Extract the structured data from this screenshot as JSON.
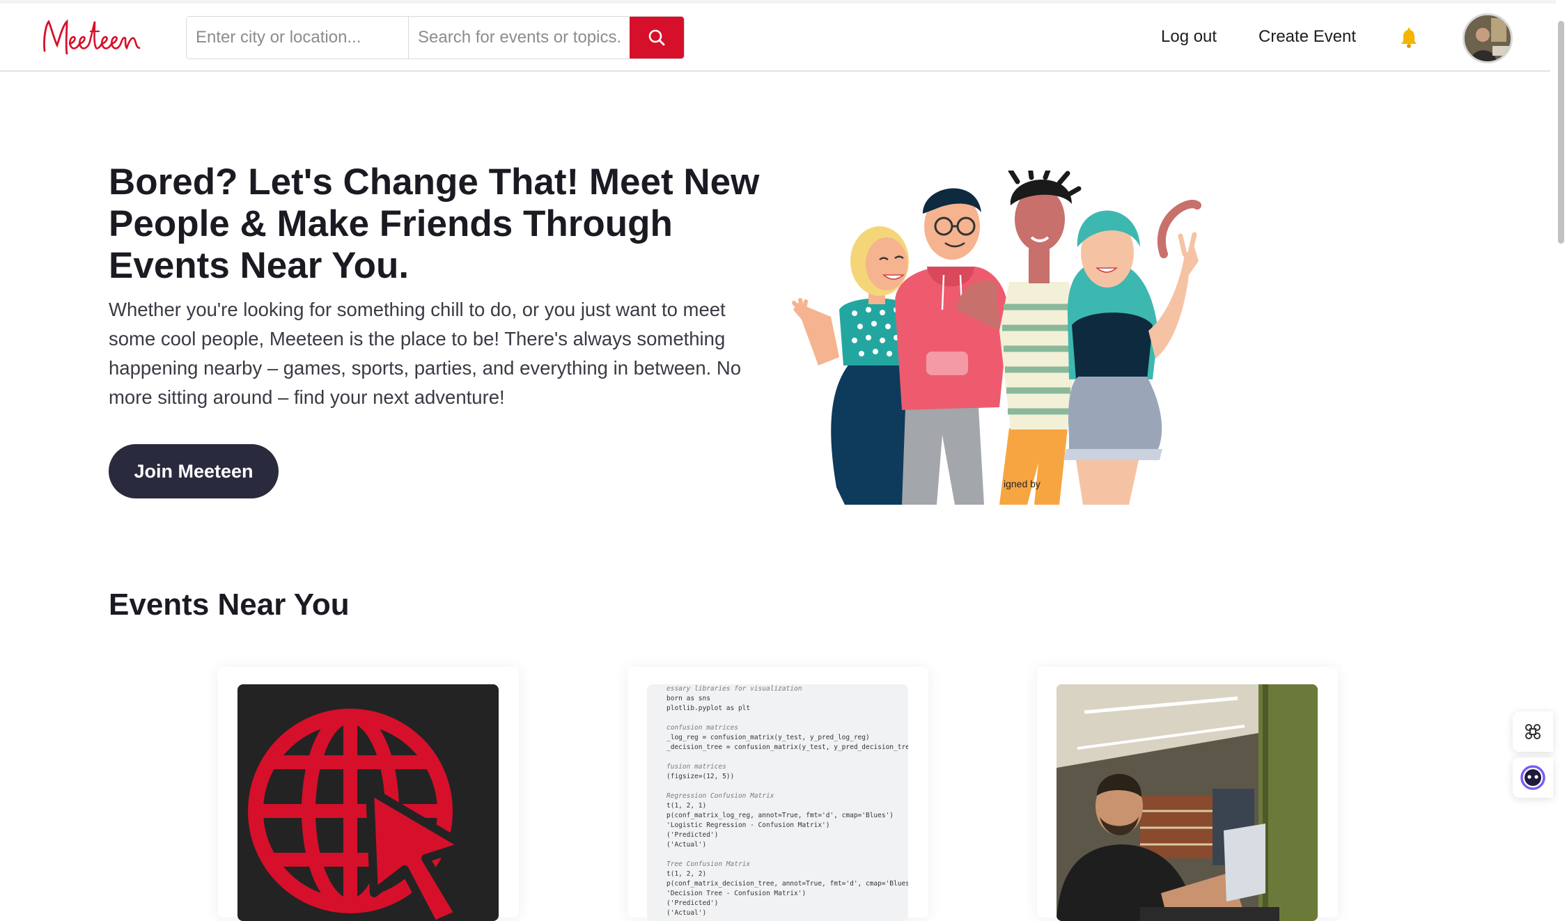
{
  "brand": {
    "name": "Meeteen",
    "color": "#d6102a"
  },
  "search": {
    "location_placeholder": "Enter city or location...",
    "topic_placeholder": "Search for events or topics...",
    "button_icon": "search-icon"
  },
  "nav": {
    "logout": "Log out",
    "create_event": "Create Event",
    "notifications_icon": "bell-icon",
    "avatar_icon": "user-avatar"
  },
  "hero": {
    "title": "Bored? Let's Change That! Meet New People & Make Friends Through Events Near You.",
    "description": "Whether you're looking for something chill to do, or you just want to meet some cool people, Meeteen is the place to be! There's always something happening nearby – games, sports, parties, and everything in between. No more sitting around – find your next adventure!",
    "cta": "Join Meeteen",
    "illustration_credit": "igned by"
  },
  "events": {
    "title": "Events Near You",
    "cards": [
      {
        "image": "globe-cursor-icon"
      },
      {
        "image": "code-screenshot"
      },
      {
        "image": "person-at-laptop-photo"
      }
    ],
    "code_lines": [
      {
        "text": "essary libraries for visualization",
        "comment": true
      },
      {
        "text": "born as sns",
        "comment": false
      },
      {
        "text": "plotlib.pyplot as plt",
        "comment": false
      },
      {
        "text": "",
        "comment": false
      },
      {
        "text": "confusion matrices",
        "comment": true
      },
      {
        "text": "_log_reg = confusion_matrix(y_test, y_pred_log_reg)",
        "comment": false
      },
      {
        "text": "_decision_tree = confusion_matrix(y_test, y_pred_decision_tree)",
        "comment": false
      },
      {
        "text": "",
        "comment": false
      },
      {
        "text": "fusion matrices",
        "comment": true
      },
      {
        "text": "(figsize=(12, 5))",
        "comment": false
      },
      {
        "text": "",
        "comment": false
      },
      {
        "text": "Regression Confusion Matrix",
        "comment": true
      },
      {
        "text": "t(1, 2, 1)",
        "comment": false
      },
      {
        "text": "p(conf_matrix_log_reg, annot=True, fmt='d', cmap='Blues')",
        "comment": false
      },
      {
        "text": "'Logistic Regression - Confusion Matrix')",
        "comment": false
      },
      {
        "text": "('Predicted')",
        "comment": false
      },
      {
        "text": "('Actual')",
        "comment": false
      },
      {
        "text": "",
        "comment": false
      },
      {
        "text": "Tree Confusion Matrix",
        "comment": true
      },
      {
        "text": "t(1, 2, 2)",
        "comment": false
      },
      {
        "text": "p(conf_matrix_decision_tree, annot=True, fmt='d', cmap='Blues')",
        "comment": false
      },
      {
        "text": "'Decision Tree - Confusion Matrix')",
        "comment": false
      },
      {
        "text": "('Predicted')",
        "comment": false
      },
      {
        "text": "('Actual')",
        "comment": false
      }
    ]
  },
  "widgets": [
    {
      "icon": "command-icon"
    },
    {
      "icon": "assistant-face-icon"
    }
  ],
  "colors": {
    "dark_button": "#2a2a3e",
    "accent_red": "#d6102a",
    "bell": "#f4b400"
  }
}
